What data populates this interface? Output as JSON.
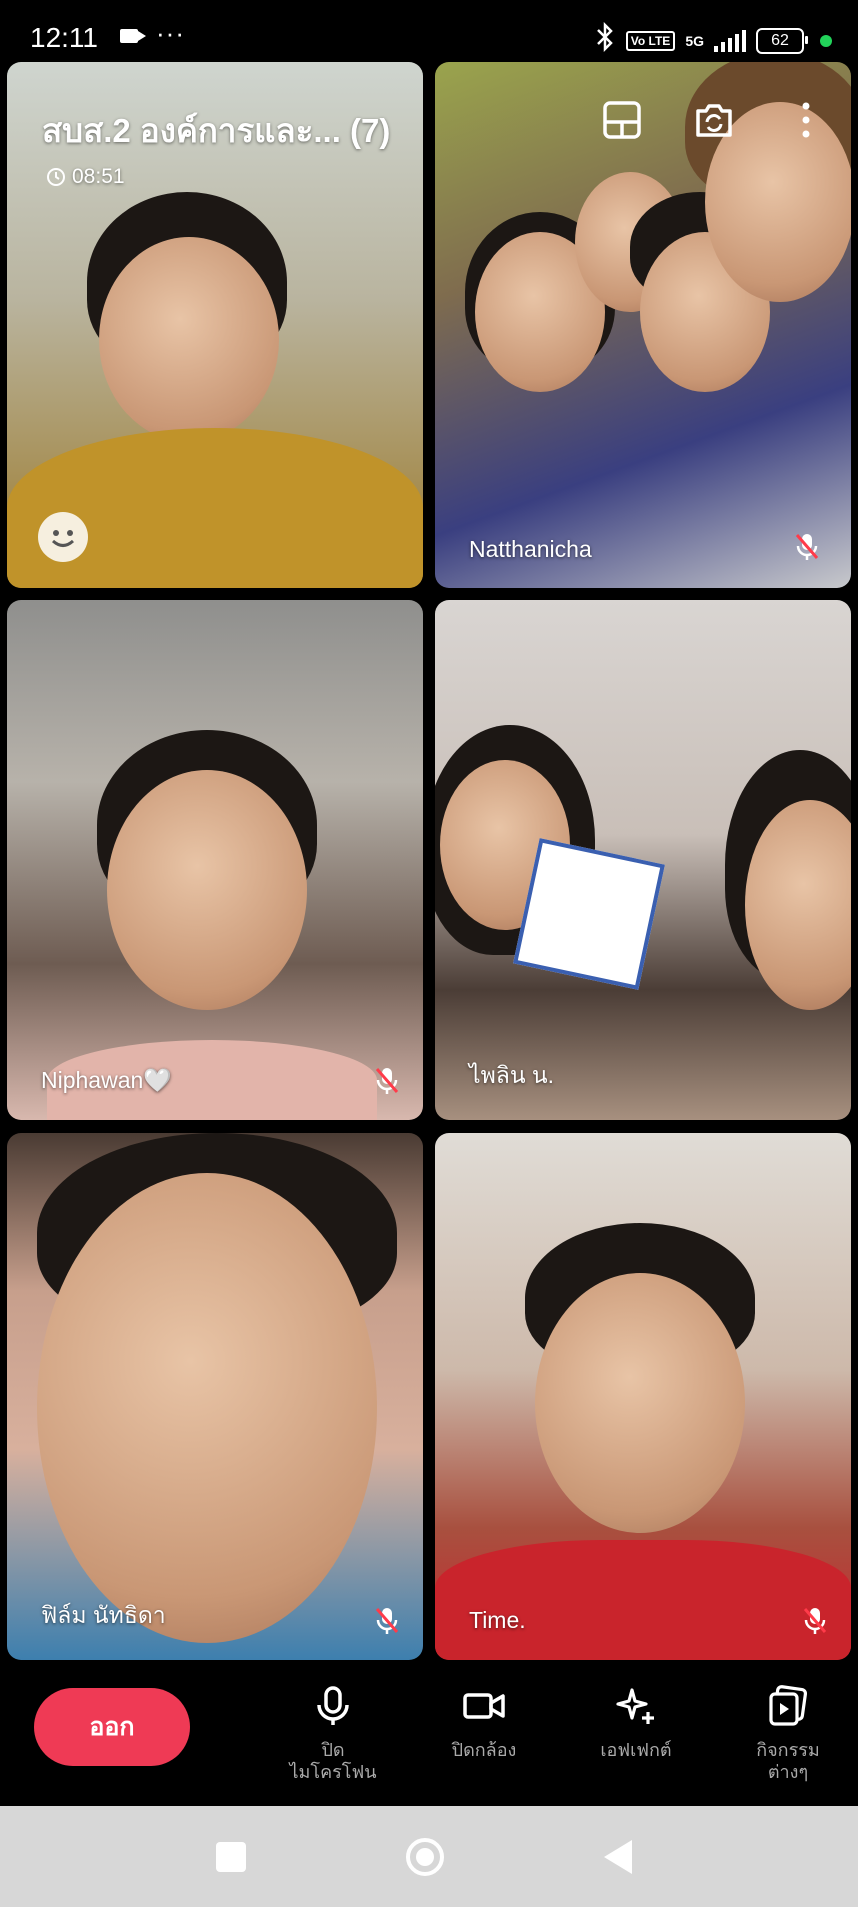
{
  "status_bar": {
    "time": "12:11",
    "overflow": "···",
    "volte": "Vo LTE",
    "network": "5G",
    "battery": "62",
    "icons": [
      "video-camera-icon",
      "bluetooth-icon",
      "signal-icon",
      "battery-icon",
      "mic-privacy-dot-icon"
    ]
  },
  "call": {
    "title": "สบส.2 องค์การและ... (7)",
    "duration": "08:51",
    "top_icons": [
      "layout-icon",
      "switch-camera-icon",
      "more-icon"
    ]
  },
  "participants": [
    {
      "name": "",
      "muted": false,
      "reaction_icon": "emoji-icon"
    },
    {
      "name": "Natthanicha",
      "muted": true
    },
    {
      "name": "Niphawan🤍",
      "muted": true
    },
    {
      "name": "ไพลิน น.",
      "muted": false
    },
    {
      "name": "ฟิล์ม นัทธิดา",
      "muted": true
    },
    {
      "name": "Time.",
      "muted": true
    }
  ],
  "controls": {
    "leave": "ออก",
    "mic": [
      "ปิด",
      "ไมโครโฟน"
    ],
    "camera": "ปิดกล้อง",
    "effects": "เอฟเฟกต์",
    "activities": [
      "กิจกรรม",
      "ต่างๆ"
    ]
  },
  "colors": {
    "leave_button": "#ef3a55",
    "background": "#000000",
    "nav_bar": "#d7d7d7"
  }
}
